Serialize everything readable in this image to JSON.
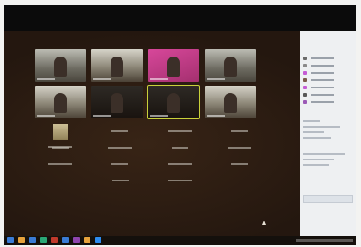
{
  "participants": [
    {
      "name": "",
      "tone": "outdoor",
      "active": false
    },
    {
      "name": "",
      "tone": "bright",
      "active": false
    },
    {
      "name": "",
      "tone": "pink",
      "active": false
    },
    {
      "name": "",
      "tone": "outdoor",
      "active": false
    },
    {
      "name": "",
      "tone": "bright",
      "active": false
    },
    {
      "name": "",
      "tone": "dark",
      "active": false
    },
    {
      "name": "",
      "tone": "dark",
      "active": true
    },
    {
      "name": "",
      "tone": "bright",
      "active": false
    }
  ],
  "name_rows": [
    [
      {
        "name": "",
        "photo": true
      },
      {
        "name": ""
      },
      {
        "name": ""
      },
      {
        "name": ""
      }
    ],
    [
      {
        "name": ""
      },
      {
        "name": ""
      },
      {
        "name": ""
      },
      {
        "name": ""
      }
    ],
    [
      {
        "name": ""
      },
      {
        "name": ""
      },
      {
        "name": ""
      },
      {
        "name": ""
      }
    ],
    [
      {
        "name": ""
      },
      {
        "name": ""
      }
    ]
  ],
  "panel": {
    "title": "",
    "avatar_colors": [
      "#6b6b6b",
      "#8a8a8a",
      "#c55bd4",
      "#7a5a48",
      "#c55bd4",
      "#585858",
      "#9b59b6"
    ]
  },
  "taskbar": {
    "icon_colors": [
      "#3a7bd5",
      "#e6a23c",
      "#3a7bd5",
      "#2aa876",
      "#c0392b",
      "#3a7bd5",
      "#8e44ad",
      "#e6a23c",
      "#2d8cf0"
    ]
  }
}
